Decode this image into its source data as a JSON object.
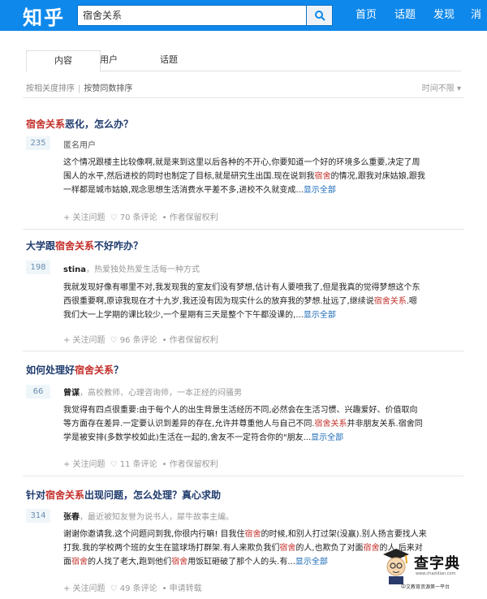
{
  "header": {
    "logo": "知乎",
    "search_value": "宿舍关系",
    "nav": [
      "首页",
      "话题",
      "发现",
      "消息"
    ],
    "accent": "#0f88eb"
  },
  "tabs": [
    "内容",
    "用户",
    "话题"
  ],
  "sort": {
    "option1": "按相关度排序",
    "option2": "按赞同数排序",
    "time": "时间不限 ▾"
  },
  "results": [
    {
      "title_hl": "宿舍关系",
      "title_rest": "恶化，怎么办？",
      "votes": "235",
      "author": "匿名用户",
      "bio": "",
      "c1": "这个情况跟楼主比较像啊,就是来到这里以后各种的不开心,你要知道一个好的环境多么重要,决定了周",
      "c2a": "围人的水平,然后进校的同时也制定了目标,就是研究生出国.现在说到我",
      "c2hl": "宿舍",
      "c2b": "的情况,跟我对床姑娘,跟我",
      "c3": "一样都是城市姑娘,观念思想生活消费水平差不多,进校不久就变成...",
      "more": "显示全部",
      "follow": "+ 关注问题",
      "comments": "♡ 70 条评论",
      "right": "• 作者保留权利"
    },
    {
      "title_pre": "大学跟",
      "title_hl": "宿舍关系",
      "title_rest": "不好咋办？",
      "votes": "198",
      "author": "stina",
      "bio": "，热爱独处热爱生活每一种方式",
      "c1": "我就发现好像有哪里不对,我发现我的室友们没有梦想,估计有人要喷我了,但是我真的觉得梦想这个东",
      "c2": "西很重要啊,原谅我现在才十九岁,我还没有因为现实什么的放弃我的梦想.扯远了,继续说",
      "c2hl": "宿舍关系",
      "c2b": ".嗯",
      "c3": "我们大一上学期的课比较少,一个星期有三天是整个下午都没课的,...",
      "more": "显示全部",
      "follow": "+ 关注问题",
      "comments": "♡ 96 条评论",
      "right": "• 作者保留权利"
    },
    {
      "title_pre": "如何处理好",
      "title_hl": "宿舍关系",
      "title_rest": "？",
      "votes": "66",
      "author": "曾谋",
      "bio": "，高校教师、心理咨询师，一本正经的闷骚男",
      "c1": "我觉得有四点很重要:由于每个人的出生背景生活经历不同,必然会在生活习惯、兴趣爱好、价值取向",
      "c2a": "等方面存在差异.一定要认识到差异的存在,允许并尊重他人与自己不同.",
      "c2hl": "宿舍关系",
      "c2b": "并非朋友关系.宿舍同",
      "c3": "学是被安排(多数学校如此)生活在一起的,舍友不一定符合你的\"朋友...",
      "more": "显示全部",
      "follow": "+ 关注问题",
      "comments": "♡ 11 条评论",
      "right": "• 作者保留权利"
    },
    {
      "title_pre": "针对",
      "title_hl": "宿舍关系",
      "title_rest": "出现问题，怎么处理？真心求助",
      "votes": "314",
      "author": "张春",
      "bio": "，最近被知友誉为说书人，犀牛故事主编。",
      "c1a": "谢谢你邀请我.这个问题问到我,你很内行嘛! 目我住",
      "c1hl": "宿舍",
      "c1b": "的时候,和别人打过架(没赢).别人扬言要找人来",
      "c2a": "打我.我的学校两个班的女生在篮球场打群架.有人来欺负我们",
      "c2hl": "宿舍",
      "c2b": "的人,也欺负了对面",
      "c2hl2": "宿舍",
      "c2c": "的人.后来对",
      "c3a": "面",
      "c3hl": "宿舍",
      "c3b": "的人找了老大,跑到他们",
      "c3hl2": "宿舍",
      "c3c": "用饭缸砸破了那个人的头.有...",
      "more": "显示全部",
      "follow": "+ 关注问题",
      "comments": "♡ 49 条评论",
      "right": "• 申请转载"
    }
  ],
  "watermark": {
    "name": "查字典",
    "site": "www.chazidian.com",
    "slogan": "中文教育资源第一平台"
  }
}
